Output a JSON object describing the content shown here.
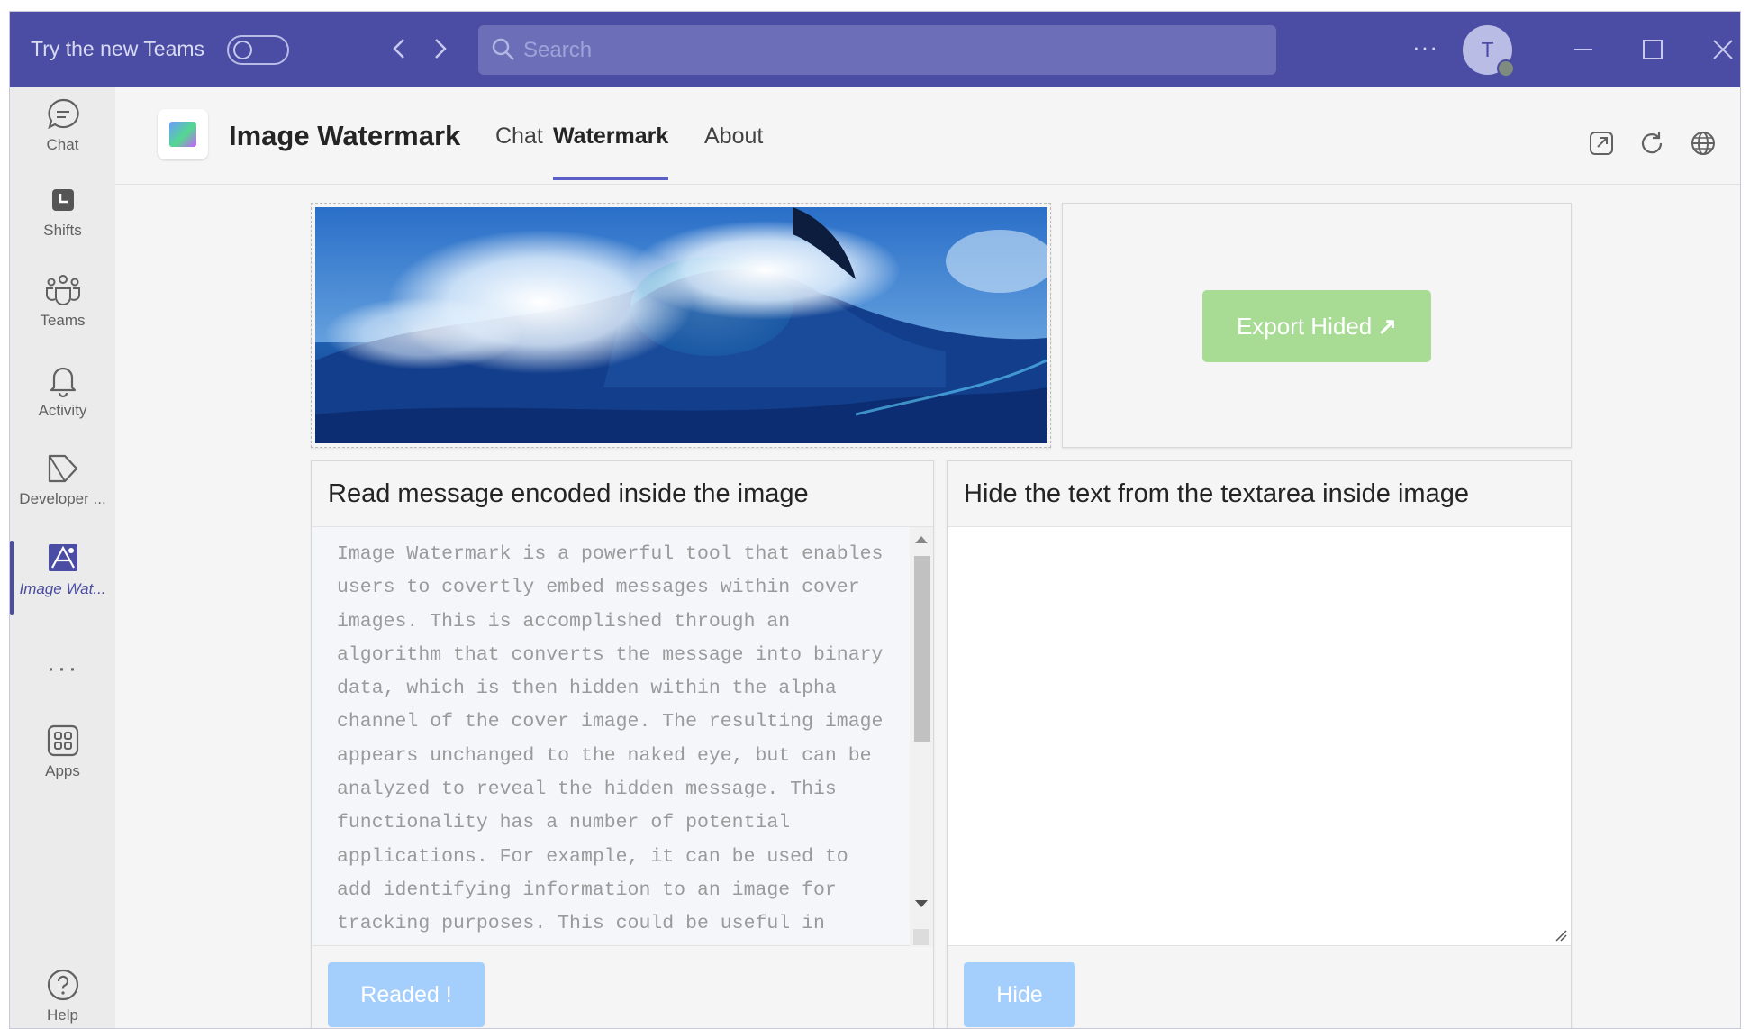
{
  "titlebar": {
    "try_label": "Try the new Teams",
    "search_placeholder": "Search",
    "more": "···",
    "avatar_initial": "T"
  },
  "rail": {
    "items": [
      {
        "label": "Chat",
        "icon": "chat-icon"
      },
      {
        "label": "Shifts",
        "icon": "shifts-icon"
      },
      {
        "label": "Teams",
        "icon": "teams-icon"
      },
      {
        "label": "Activity",
        "icon": "bell-icon"
      },
      {
        "label": "Developer ...",
        "icon": "developer-icon"
      },
      {
        "label": "Image Wat...",
        "icon": "image-watermark-icon",
        "active": true
      },
      {
        "label": "Apps",
        "icon": "apps-icon"
      },
      {
        "label": "Help",
        "icon": "help-icon"
      }
    ],
    "more": "···"
  },
  "app": {
    "title": "Image Watermark",
    "tabs": [
      {
        "label": "Chat"
      },
      {
        "label": "Watermark",
        "active": true
      },
      {
        "label": "About"
      }
    ]
  },
  "export": {
    "label": "Export Hided"
  },
  "read_panel": {
    "heading": "Read message encoded inside the image",
    "text": "Image Watermark is a powerful tool that enables\nusers to covertly embed messages within cover\nimages. This is accomplished through an\nalgorithm that converts the message into binary\ndata, which is then hidden within the alpha\nchannel of the cover image. The resulting image\nappears unchanged to the naked eye, but can be\nanalyzed to reveal the hidden message. This\nfunctionality has a number of potential\napplications. For example, it can be used to\nadd identifying information to an image for\ntracking purposes. This could be useful in",
    "button": "Readed !"
  },
  "hide_panel": {
    "heading": "Hide the text from the textarea inside image",
    "value": "",
    "button": "Hide"
  },
  "colors": {
    "titlebar": "#4a4da3",
    "accent": "#5b5fc7",
    "export_button": "#a8dc95",
    "action_button": "#a4cffc"
  }
}
